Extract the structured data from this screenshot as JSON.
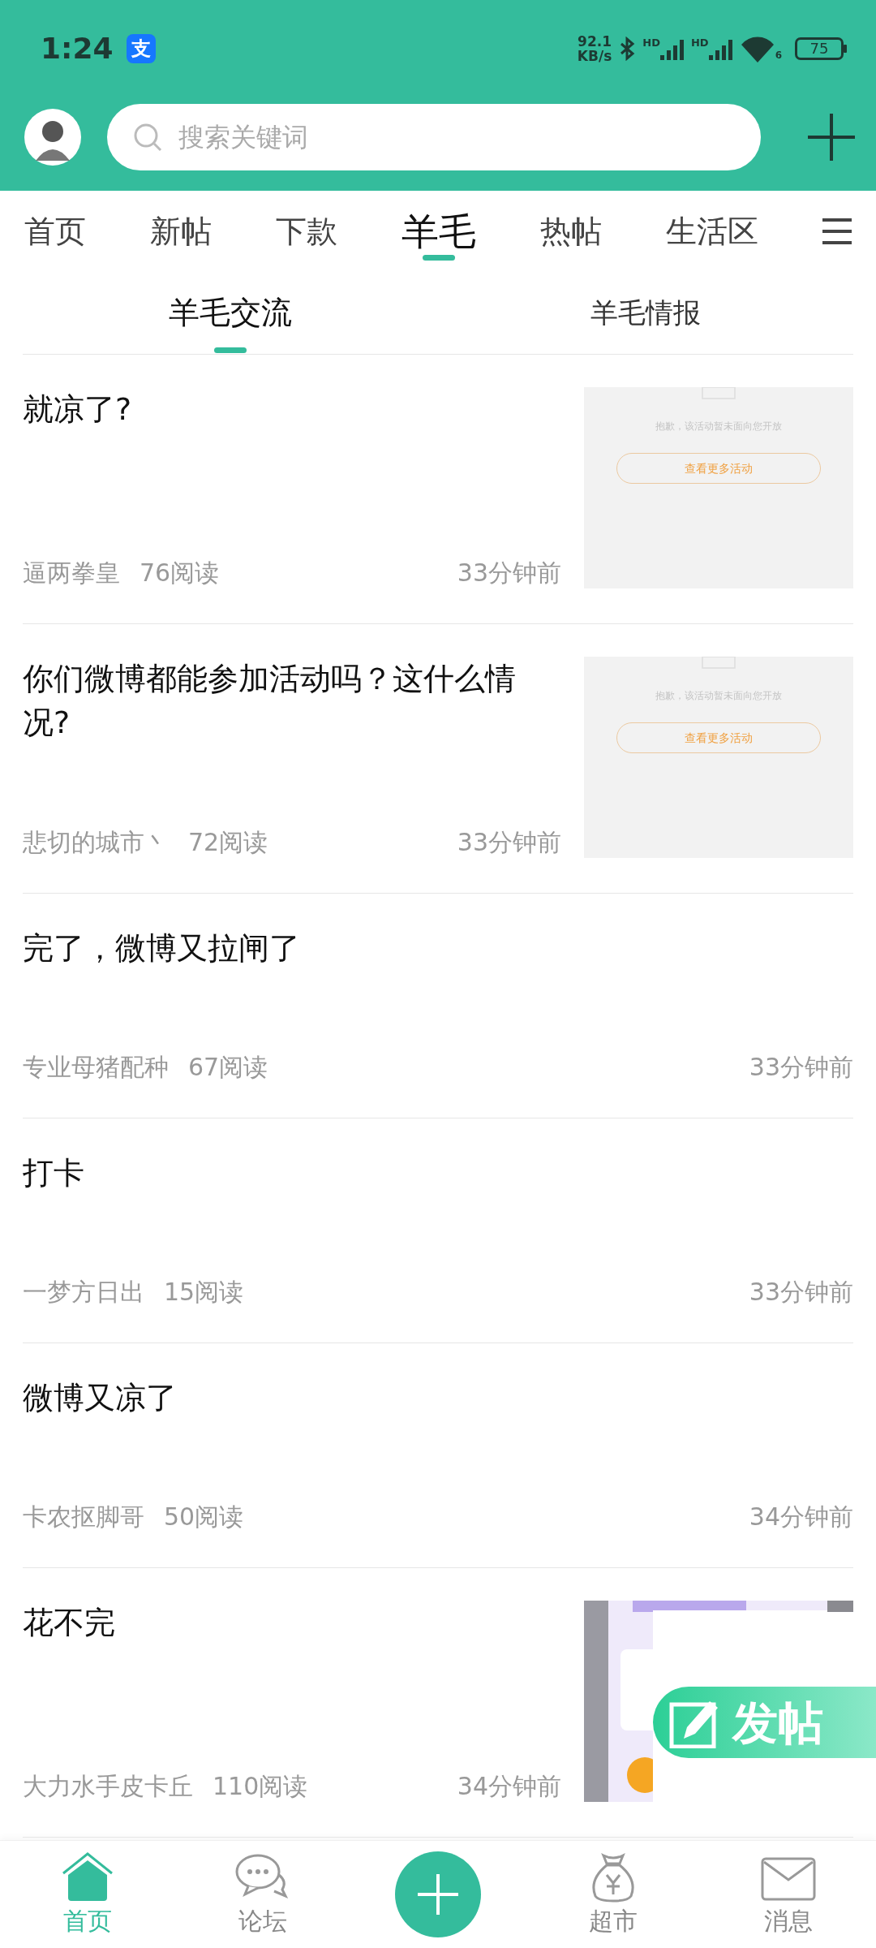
{
  "status_bar": {
    "time": "1:24",
    "app_icon_char": "支",
    "net_speed_value": "92.1",
    "net_speed_unit": "KB/s",
    "signal_labels": [
      "HD",
      "HD"
    ],
    "wifi_label": "6",
    "battery": "75"
  },
  "header": {
    "search": {
      "placeholder": "搜索关键词"
    }
  },
  "tabs": [
    {
      "label": "首页",
      "selected": false
    },
    {
      "label": "新帖",
      "selected": false
    },
    {
      "label": "下款",
      "selected": false
    },
    {
      "label": "羊毛",
      "selected": true
    },
    {
      "label": "热帖",
      "selected": false
    },
    {
      "label": "生活区",
      "selected": false
    }
  ],
  "sub_tabs": [
    {
      "label": "羊毛交流",
      "selected": true
    },
    {
      "label": "羊毛情报",
      "selected": false
    }
  ],
  "posts": [
    {
      "title": "就凉了?",
      "author": "逼两拳皇",
      "reads": "76阅读",
      "time": "33分钟前",
      "thumbnail": {
        "kind": "screenshot",
        "message": "抱歉，该活动暂未面向您开放",
        "button": "查看更多活动"
      }
    },
    {
      "title": "你们微博都能参加活动吗？这什么情况?",
      "author": "悲切的城市丶",
      "reads": "72阅读",
      "time": "33分钟前",
      "thumbnail": {
        "kind": "screenshot",
        "message": "抱歉，该活动暂未面向您开放",
        "button": "查看更多活动"
      }
    },
    {
      "title": "完了，微博又拉闸了",
      "author": "专业母猪配种",
      "reads": "67阅读",
      "time": "33分钟前"
    },
    {
      "title": "打卡",
      "author": "一梦方日出",
      "reads": "15阅读",
      "time": "33分钟前"
    },
    {
      "title": "微博又凉了",
      "author": "卡农抠脚哥",
      "reads": "50阅读",
      "time": "34分钟前"
    },
    {
      "title": "花不完",
      "author": "大力水手皮卡丘",
      "reads": "110阅读",
      "time": "34分钟前"
    }
  ],
  "compose_button": {
    "label": "发帖"
  },
  "bottom_nav": [
    {
      "kind": "home",
      "label": "首页",
      "selected": true
    },
    {
      "kind": "forum",
      "label": "论坛",
      "selected": false
    },
    {
      "kind": "add"
    },
    {
      "kind": "market",
      "label": "超市",
      "selected": false
    },
    {
      "kind": "messages",
      "label": "消息",
      "selected": false
    }
  ]
}
